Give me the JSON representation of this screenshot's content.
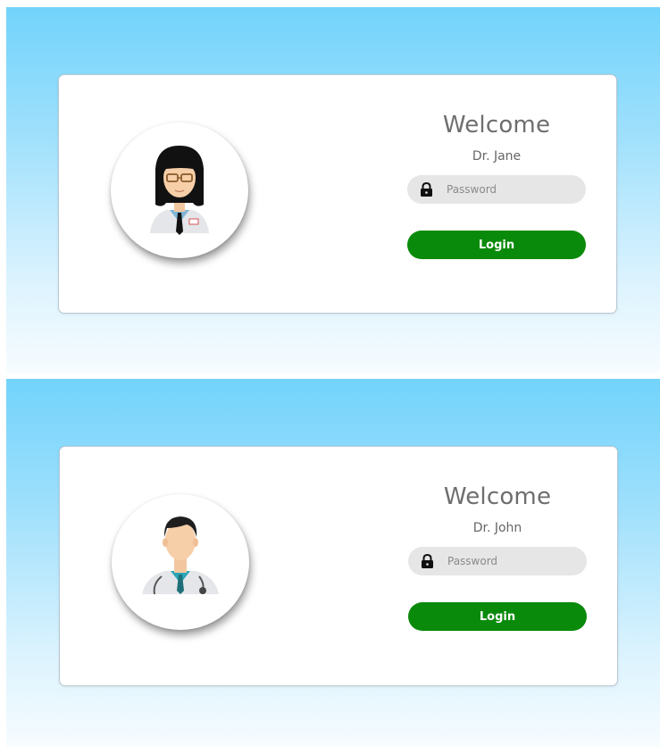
{
  "screens": [
    {
      "welcome": "Welcome",
      "doctor_name": "Dr. Jane",
      "password_placeholder": "Password",
      "login_label": "Login",
      "avatar_icon": "female-doctor-avatar-icon",
      "lock_icon": "lock-icon"
    },
    {
      "welcome": "Welcome",
      "doctor_name": "Dr. John",
      "password_placeholder": "Password",
      "login_label": "Login",
      "avatar_icon": "male-doctor-avatar-icon",
      "lock_icon": "lock-icon"
    }
  ],
  "colors": {
    "background_top": "#72d3fb",
    "background_bottom": "#f7fcff",
    "login_button": "#0a8a0a",
    "input_background": "#e6e6e6",
    "heading_text": "#6e6e6e"
  }
}
